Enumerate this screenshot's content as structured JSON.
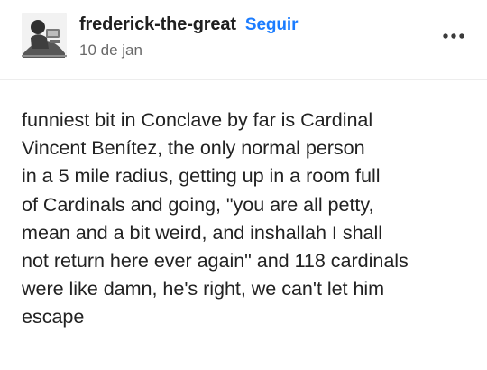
{
  "post": {
    "author": {
      "username": "frederick-the-great",
      "avatar_description": "avatar"
    },
    "follow_label": "Seguir",
    "date": "10 de jan",
    "menu_icon": "more-horizontal-icon",
    "body_lines": [
      "funniest bit in Conclave by far is Cardinal",
      "Vincent Benítez, the only normal person",
      "in a 5 mile radius, getting up in a room full",
      "of Cardinals and going, \"you are all petty,",
      "mean and a bit weird, and inshallah I shall",
      "not return here ever again\" and 118 cardinals",
      "were like damn, he's right, we can't let him",
      "escape"
    ],
    "colors": {
      "follow": "#1b7cff",
      "text": "#222222",
      "date": "#696969",
      "divider": "#ededed"
    }
  }
}
